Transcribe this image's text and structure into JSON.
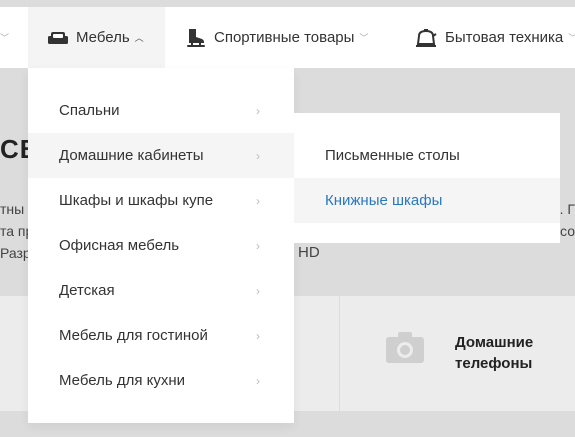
{
  "nav": {
    "items": [
      {
        "label": "Мебель",
        "icon": "sofa-icon"
      },
      {
        "label": "Спортивные товары",
        "icon": "ice-skate-icon"
      },
      {
        "label": "Бытовая техника",
        "icon": "kettle-icon"
      }
    ]
  },
  "background": {
    "title": "СВ",
    "line1_left": "тны",
    "line2_left": "та пр",
    "line3_left": "Разр",
    "hd": "HD",
    "line1_right": ". Г",
    "line2_right": "со",
    "card_title": "Домашние телефоны"
  },
  "menu": {
    "items": [
      {
        "label": "Спальни"
      },
      {
        "label": "Домашние кабинеты"
      },
      {
        "label": "Шкафы и шкафы купе"
      },
      {
        "label": "Офисная мебель"
      },
      {
        "label": "Детская"
      },
      {
        "label": "Мебель для гостиной"
      },
      {
        "label": "Мебель для кухни"
      }
    ],
    "active_index": 1
  },
  "submenu": {
    "items": [
      {
        "label": "Письменные столы"
      },
      {
        "label": "Книжные шкафы"
      }
    ],
    "hover_index": 1
  },
  "colors": {
    "link_hover": "#2b78c2",
    "background_overlay": "#dcdcdc"
  }
}
